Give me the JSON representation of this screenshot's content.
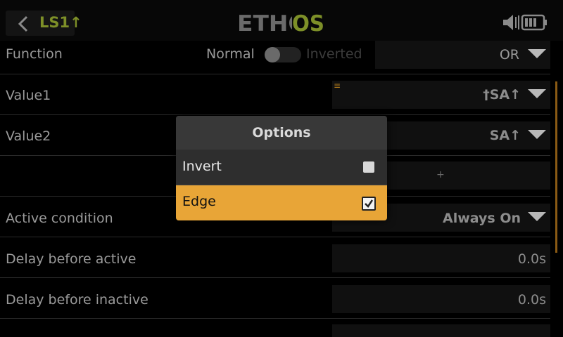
{
  "header": {
    "title": "LS1↑",
    "logo": "ETHOS",
    "back_icon": "chevron-left-icon",
    "speaker_icon": "speaker-muted-icon",
    "battery_icon": "battery-icon"
  },
  "rows": {
    "function": {
      "label": "Function",
      "toggle_off_label": "Normal",
      "toggle_on_label": "Inverted",
      "value": "OR"
    },
    "value1": {
      "label": "Value1",
      "value": "†SA↑",
      "marker": "≡"
    },
    "value2": {
      "label": "Value2",
      "value": "SA↑"
    },
    "add": {
      "value": "+"
    },
    "active_condition": {
      "label": "Active condition",
      "value": "Always On"
    },
    "delay_active": {
      "label": "Delay before active",
      "value": "0.0s"
    },
    "delay_inactive": {
      "label": "Delay before inactive",
      "value": "0.0s"
    }
  },
  "dialog": {
    "title": "Options",
    "items": [
      {
        "label": "Invert",
        "checked": false
      },
      {
        "label": "Edge",
        "checked": true
      }
    ]
  },
  "colors": {
    "accent": "#e8a537",
    "logo_green": "#7d8f28",
    "background": "#000000"
  }
}
